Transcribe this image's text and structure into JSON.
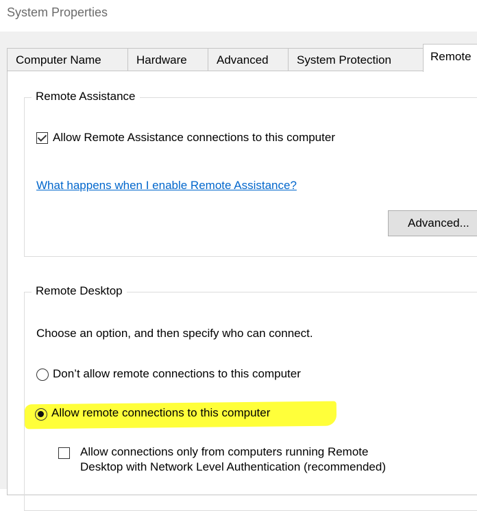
{
  "window": {
    "title": "System Properties"
  },
  "tabs": [
    "Computer Name",
    "Hardware",
    "Advanced",
    "System Protection",
    "Remote"
  ],
  "remote_assistance": {
    "legend": "Remote Assistance",
    "checkbox_label": "Allow Remote Assistance connections to this computer",
    "checked": true,
    "help_link": "What happens when I enable Remote Assistance?",
    "advanced_button": "Advanced..."
  },
  "remote_desktop": {
    "legend": "Remote Desktop",
    "instruction": "Choose an option, and then specify who can connect.",
    "option_dont_allow": "Don’t allow remote connections to this computer",
    "option_allow": "Allow remote connections to this computer",
    "selected_option": "allow",
    "nla_line1": "Allow connections only from computers running Remote",
    "nla_line2": "Desktop with Network Level Authentication (recommended)",
    "nla_checked": false
  },
  "colors": {
    "link": "#0066cc",
    "highlight": "#ffff3a"
  }
}
